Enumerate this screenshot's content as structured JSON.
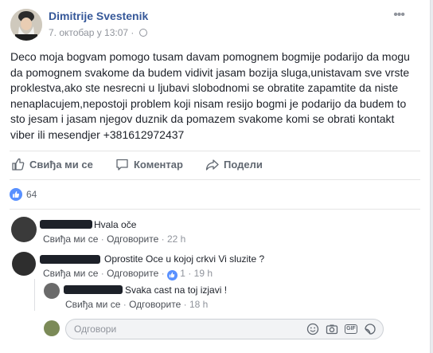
{
  "post": {
    "author": "Dimitrije Svestenik",
    "timestamp": "7. октобар у 13:07",
    "separator": "·",
    "text": "Deco moja bogvam pomogo tusam davam pomognem bogmije podarijo da mogu da pomognem svakome da budem vidivit jasam bozija sluga,unistavam sve vrste proklestva,ako ste nesrecni u ljubavi slobodnomi se obratite zapamtite da niste nenaplacujem,nepostoji problem koji nisam resijo bogmi je podarijo da budem to sto jesam i jasam njegov duznik da pomazem svakome komi se obrati kontakt viber ili mesendjer +381612972437"
  },
  "actions": {
    "like": "Свиђа ми се",
    "comment": "Коментар",
    "share": "Подели"
  },
  "reactions": {
    "count": "64"
  },
  "comments": [
    {
      "text": "Hvala oče",
      "like": "Свиђа ми се",
      "reply": "Одговорите",
      "sep": "·",
      "time": "22 h"
    },
    {
      "text": "Oprostite Oce u kojoj crkvi Vi sluzite ?",
      "like": "Свиђа ми се",
      "reply": "Одговорите",
      "sep": "·",
      "likes": "1",
      "time": "19 h"
    },
    {
      "text": "Svaka cast na toj izjavi !",
      "like": "Свиђа ми се",
      "reply": "Одговорите",
      "sep": "·",
      "time": "18 h"
    }
  ],
  "reply": {
    "placeholder": "Одговори"
  },
  "colors": {
    "link": "#365899",
    "like_blue": "#5890ff",
    "muted": "#90949c"
  },
  "icons": [
    "chevron-down-icon",
    "globe-icon",
    "like-icon",
    "comment-icon",
    "share-icon",
    "emoji-icon",
    "camera-icon",
    "gif-icon",
    "sticker-icon"
  ]
}
